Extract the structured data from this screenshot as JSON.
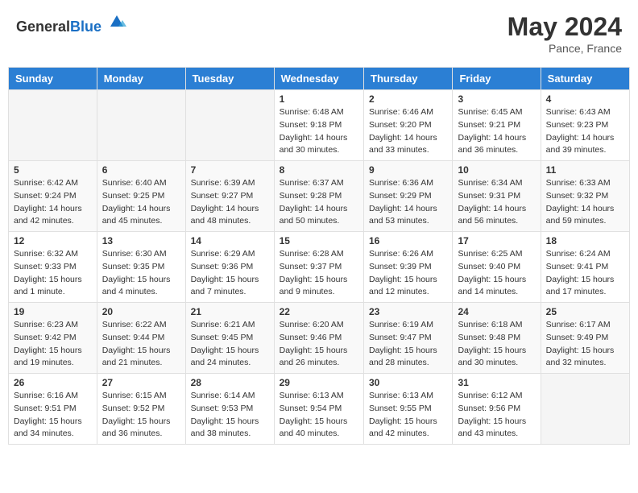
{
  "logo": {
    "general": "General",
    "blue": "Blue"
  },
  "header": {
    "month": "May 2024",
    "location": "Pance, France"
  },
  "weekdays": [
    "Sunday",
    "Monday",
    "Tuesday",
    "Wednesday",
    "Thursday",
    "Friday",
    "Saturday"
  ],
  "weeks": [
    [
      {
        "day": "",
        "sunrise": "",
        "sunset": "",
        "daylight": ""
      },
      {
        "day": "",
        "sunrise": "",
        "sunset": "",
        "daylight": ""
      },
      {
        "day": "",
        "sunrise": "",
        "sunset": "",
        "daylight": ""
      },
      {
        "day": "1",
        "sunrise": "Sunrise: 6:48 AM",
        "sunset": "Sunset: 9:18 PM",
        "daylight": "Daylight: 14 hours and 30 minutes."
      },
      {
        "day": "2",
        "sunrise": "Sunrise: 6:46 AM",
        "sunset": "Sunset: 9:20 PM",
        "daylight": "Daylight: 14 hours and 33 minutes."
      },
      {
        "day": "3",
        "sunrise": "Sunrise: 6:45 AM",
        "sunset": "Sunset: 9:21 PM",
        "daylight": "Daylight: 14 hours and 36 minutes."
      },
      {
        "day": "4",
        "sunrise": "Sunrise: 6:43 AM",
        "sunset": "Sunset: 9:23 PM",
        "daylight": "Daylight: 14 hours and 39 minutes."
      }
    ],
    [
      {
        "day": "5",
        "sunrise": "Sunrise: 6:42 AM",
        "sunset": "Sunset: 9:24 PM",
        "daylight": "Daylight: 14 hours and 42 minutes."
      },
      {
        "day": "6",
        "sunrise": "Sunrise: 6:40 AM",
        "sunset": "Sunset: 9:25 PM",
        "daylight": "Daylight: 14 hours and 45 minutes."
      },
      {
        "day": "7",
        "sunrise": "Sunrise: 6:39 AM",
        "sunset": "Sunset: 9:27 PM",
        "daylight": "Daylight: 14 hours and 48 minutes."
      },
      {
        "day": "8",
        "sunrise": "Sunrise: 6:37 AM",
        "sunset": "Sunset: 9:28 PM",
        "daylight": "Daylight: 14 hours and 50 minutes."
      },
      {
        "day": "9",
        "sunrise": "Sunrise: 6:36 AM",
        "sunset": "Sunset: 9:29 PM",
        "daylight": "Daylight: 14 hours and 53 minutes."
      },
      {
        "day": "10",
        "sunrise": "Sunrise: 6:34 AM",
        "sunset": "Sunset: 9:31 PM",
        "daylight": "Daylight: 14 hours and 56 minutes."
      },
      {
        "day": "11",
        "sunrise": "Sunrise: 6:33 AM",
        "sunset": "Sunset: 9:32 PM",
        "daylight": "Daylight: 14 hours and 59 minutes."
      }
    ],
    [
      {
        "day": "12",
        "sunrise": "Sunrise: 6:32 AM",
        "sunset": "Sunset: 9:33 PM",
        "daylight": "Daylight: 15 hours and 1 minute."
      },
      {
        "day": "13",
        "sunrise": "Sunrise: 6:30 AM",
        "sunset": "Sunset: 9:35 PM",
        "daylight": "Daylight: 15 hours and 4 minutes."
      },
      {
        "day": "14",
        "sunrise": "Sunrise: 6:29 AM",
        "sunset": "Sunset: 9:36 PM",
        "daylight": "Daylight: 15 hours and 7 minutes."
      },
      {
        "day": "15",
        "sunrise": "Sunrise: 6:28 AM",
        "sunset": "Sunset: 9:37 PM",
        "daylight": "Daylight: 15 hours and 9 minutes."
      },
      {
        "day": "16",
        "sunrise": "Sunrise: 6:26 AM",
        "sunset": "Sunset: 9:39 PM",
        "daylight": "Daylight: 15 hours and 12 minutes."
      },
      {
        "day": "17",
        "sunrise": "Sunrise: 6:25 AM",
        "sunset": "Sunset: 9:40 PM",
        "daylight": "Daylight: 15 hours and 14 minutes."
      },
      {
        "day": "18",
        "sunrise": "Sunrise: 6:24 AM",
        "sunset": "Sunset: 9:41 PM",
        "daylight": "Daylight: 15 hours and 17 minutes."
      }
    ],
    [
      {
        "day": "19",
        "sunrise": "Sunrise: 6:23 AM",
        "sunset": "Sunset: 9:42 PM",
        "daylight": "Daylight: 15 hours and 19 minutes."
      },
      {
        "day": "20",
        "sunrise": "Sunrise: 6:22 AM",
        "sunset": "Sunset: 9:44 PM",
        "daylight": "Daylight: 15 hours and 21 minutes."
      },
      {
        "day": "21",
        "sunrise": "Sunrise: 6:21 AM",
        "sunset": "Sunset: 9:45 PM",
        "daylight": "Daylight: 15 hours and 24 minutes."
      },
      {
        "day": "22",
        "sunrise": "Sunrise: 6:20 AM",
        "sunset": "Sunset: 9:46 PM",
        "daylight": "Daylight: 15 hours and 26 minutes."
      },
      {
        "day": "23",
        "sunrise": "Sunrise: 6:19 AM",
        "sunset": "Sunset: 9:47 PM",
        "daylight": "Daylight: 15 hours and 28 minutes."
      },
      {
        "day": "24",
        "sunrise": "Sunrise: 6:18 AM",
        "sunset": "Sunset: 9:48 PM",
        "daylight": "Daylight: 15 hours and 30 minutes."
      },
      {
        "day": "25",
        "sunrise": "Sunrise: 6:17 AM",
        "sunset": "Sunset: 9:49 PM",
        "daylight": "Daylight: 15 hours and 32 minutes."
      }
    ],
    [
      {
        "day": "26",
        "sunrise": "Sunrise: 6:16 AM",
        "sunset": "Sunset: 9:51 PM",
        "daylight": "Daylight: 15 hours and 34 minutes."
      },
      {
        "day": "27",
        "sunrise": "Sunrise: 6:15 AM",
        "sunset": "Sunset: 9:52 PM",
        "daylight": "Daylight: 15 hours and 36 minutes."
      },
      {
        "day": "28",
        "sunrise": "Sunrise: 6:14 AM",
        "sunset": "Sunset: 9:53 PM",
        "daylight": "Daylight: 15 hours and 38 minutes."
      },
      {
        "day": "29",
        "sunrise": "Sunrise: 6:13 AM",
        "sunset": "Sunset: 9:54 PM",
        "daylight": "Daylight: 15 hours and 40 minutes."
      },
      {
        "day": "30",
        "sunrise": "Sunrise: 6:13 AM",
        "sunset": "Sunset: 9:55 PM",
        "daylight": "Daylight: 15 hours and 42 minutes."
      },
      {
        "day": "31",
        "sunrise": "Sunrise: 6:12 AM",
        "sunset": "Sunset: 9:56 PM",
        "daylight": "Daylight: 15 hours and 43 minutes."
      },
      {
        "day": "",
        "sunrise": "",
        "sunset": "",
        "daylight": ""
      }
    ]
  ]
}
